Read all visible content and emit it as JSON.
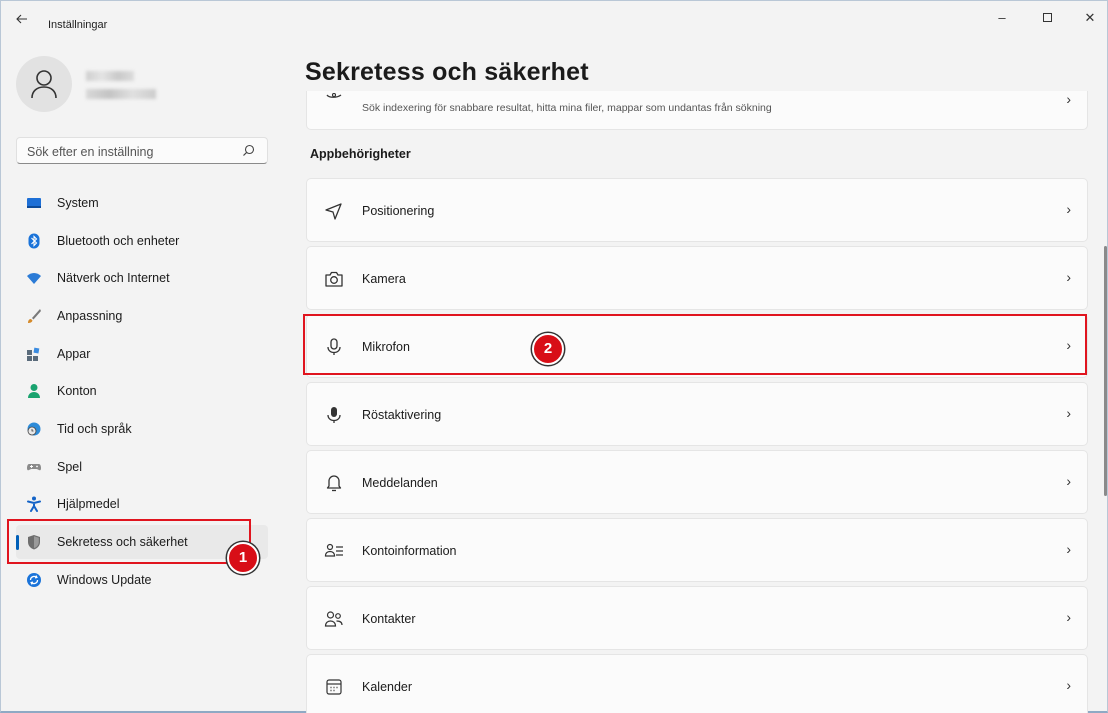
{
  "window": {
    "title": "Inställningar",
    "back_icon": "arrow-left-icon",
    "minimize_glyph": "–",
    "close_glyph": "✕"
  },
  "sidebar": {
    "search_placeholder": "Sök efter en inställning",
    "items": [
      {
        "label": "System",
        "icon": "monitor-icon",
        "color": "#1d6fd6"
      },
      {
        "label": "Bluetooth och enheter",
        "icon": "bluetooth-icon",
        "color": "#1a73d9"
      },
      {
        "label": "Nätverk och Internet",
        "icon": "wifi-icon",
        "color": "#2b7bd6"
      },
      {
        "label": "Anpassning",
        "icon": "brush-icon",
        "color": "#d58a2a"
      },
      {
        "label": "Appar",
        "icon": "apps-icon",
        "color": "#5a6b7b"
      },
      {
        "label": "Konton",
        "icon": "person-icon",
        "color": "#1aa36f"
      },
      {
        "label": "Tid och språk",
        "icon": "globe-clock-icon",
        "color": "#2d8bd8"
      },
      {
        "label": "Spel",
        "icon": "gamepad-icon",
        "color": "#7a7a7a"
      },
      {
        "label": "Hjälpmedel",
        "icon": "accessibility-icon",
        "color": "#1463c7"
      },
      {
        "label": "Sekretess och säkerhet",
        "icon": "shield-icon",
        "color": "#6e6e6e",
        "active": true
      },
      {
        "label": "Windows Update",
        "icon": "update-icon",
        "color": "#1a73d9"
      }
    ]
  },
  "main": {
    "title": "Sekretess och säkerhet",
    "top_card_sub": "Sök indexering för snabbare resultat, hitta mina filer, mappar som undantas från sökning",
    "section": "Appbehörigheter",
    "cards": [
      {
        "label": "Positionering",
        "icon": "location-icon"
      },
      {
        "label": "Kamera",
        "icon": "camera-icon"
      },
      {
        "label": "Mikrofon",
        "icon": "microphone-icon"
      },
      {
        "label": "Röstaktivering",
        "icon": "voice-activation-icon"
      },
      {
        "label": "Meddelanden",
        "icon": "bell-icon"
      },
      {
        "label": "Kontoinformation",
        "icon": "account-info-icon"
      },
      {
        "label": "Kontakter",
        "icon": "contacts-icon"
      },
      {
        "label": "Kalender",
        "icon": "calendar-icon"
      }
    ],
    "chevron": "›"
  },
  "annotations": {
    "badge1": "1",
    "badge2": "2",
    "color": "#e0141e"
  }
}
